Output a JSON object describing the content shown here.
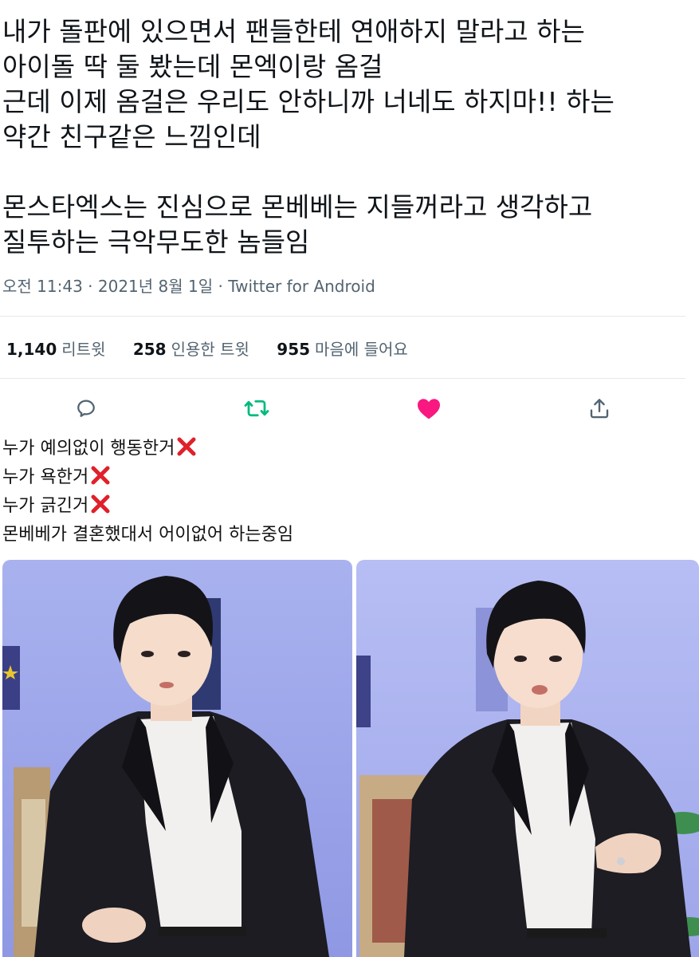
{
  "tweet": {
    "text_lines": [
      "내가 돌판에 있으면서 팬들한테 연애하지 말라고 하는",
      "아이돌 딱 둘 봤는데 몬엑이랑 옴걸",
      "근데 이제 옴걸은 우리도 안하니까 너네도 하지마!! 하는",
      "약간 친구같은 느낌인데",
      "",
      "몬스타엑스는 진심으로 몬베베는 지들꺼라고 생각하고",
      "질투하는 극악무도한 놈들임"
    ],
    "timestamp": "오전 11:43 · 2021년 8월 1일 · ",
    "source": "Twitter for Android",
    "stats": {
      "retweets_count": "1,140",
      "retweets_label": "리트윗",
      "quotes_count": "258",
      "quotes_label": "인용한 트윗",
      "likes_count": "955",
      "likes_label": "마음에 들어요"
    },
    "actions": {
      "reply_icon": "reply-icon",
      "retweet_icon": "retweet-icon",
      "like_icon": "heart-icon",
      "share_icon": "share-icon"
    },
    "colors": {
      "text": "#0f1419",
      "muted": "#536471",
      "retweet_green": "#00ba7c",
      "like_pink": "#f91880",
      "divider": "#e7e9ea"
    }
  },
  "meme": {
    "lines": [
      {
        "text": "누가 예의없이 행동한거",
        "mark": "x-mark-icon"
      },
      {
        "text": "누가 욕한거",
        "mark": "x-mark-icon"
      },
      {
        "text": "누가 긁긴거",
        "mark": "x-mark-icon"
      },
      {
        "text": "몬베베가 결혼했대서 어이없어 하는중임",
        "mark": ""
      }
    ],
    "mark_color": "#e0202a",
    "photos": [
      {
        "name": "photo-left",
        "background": "#aab3ee"
      },
      {
        "name": "photo-right",
        "background": "#b6bdf3"
      }
    ]
  }
}
